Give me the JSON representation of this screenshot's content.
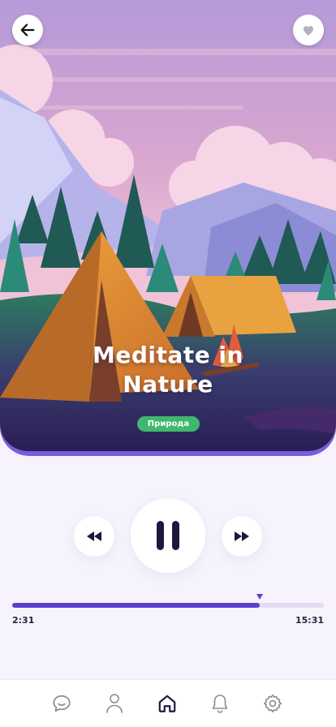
{
  "player": {
    "title": "Meditate in\nNature",
    "tag": "Природа",
    "current_time": "2:31",
    "total_time": "15:31",
    "progress": 0.795
  },
  "colors": {
    "accent": "#5b3fd0",
    "tag": "#3fb86f",
    "track": "#e4dcf7"
  },
  "icons": {
    "back": "arrow-left-icon",
    "favorite": "heart-icon",
    "rewind": "rewind-icon",
    "pause": "pause-icon",
    "forward": "fast-forward-icon"
  },
  "navbar": {
    "items": [
      {
        "icon": "chat-icon",
        "active": false
      },
      {
        "icon": "user-icon",
        "active": false
      },
      {
        "icon": "home-icon",
        "active": true
      },
      {
        "icon": "bell-icon",
        "active": false
      },
      {
        "icon": "gear-icon",
        "active": false
      }
    ]
  }
}
